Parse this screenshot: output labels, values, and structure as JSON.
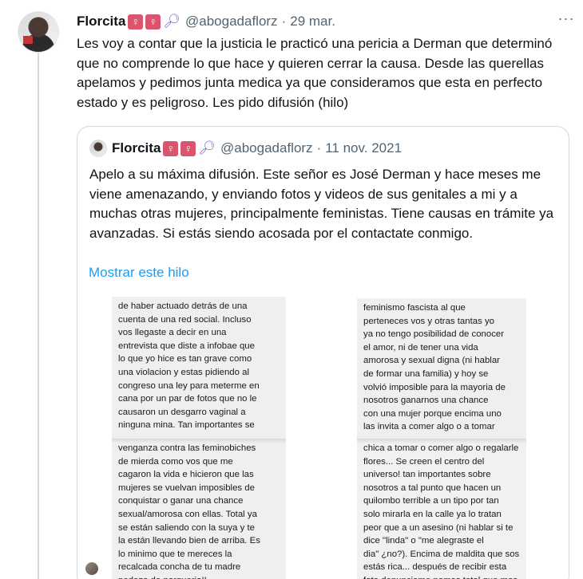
{
  "tweet": {
    "author_name": "Florcita",
    "emojis": [
      "♀",
      "♀"
    ],
    "handle": "@abogadaflorz",
    "separator": "·",
    "date": "29 mar.",
    "text": "Les voy a contar que la justicia le practicó una pericia a Derman que determinó que no comprende lo que hace y quieren cerrar la causa. Desde las querellas apelamos y pedimos junta medica ya que consideramos que esta en perfecto estado y es peligroso. Les pido difusión (hilo)",
    "more_label": "···"
  },
  "quoted_tweet": {
    "author_name": "Florcita",
    "emojis": [
      "♀",
      "♀"
    ],
    "handle": "@abogadaflorz",
    "separator": "·",
    "date": "11 nov. 2021",
    "text": "Apelo a su máxima difusión. Este señor es José Derman y hace meses me viene amenazando, y enviando fotos y videos de sus genitales a mi y a muchas otras mujeres, principalmente feministas. Tiene causas en trámite ya avanzadas. Si estás siendo acosada por el contactate conmigo.",
    "show_thread_label": "Mostrar este hilo"
  },
  "screenshots": [
    "de haber actuado detrás de una\ncuenta de una red social. Incluso\nvos llegaste a decir en una\nentrevista que diste a infobae que\nlo que yo hice es tan grave como\nuna violacion y estas pidiendo al\ncongreso una ley para meterme en\ncana por un par de fotos que no le\ncausaron un desgarro vaginal a\nninguna mina. Tan importantes se",
    "venganza contra las feminobiches\nde mierda como vos que me\ncagaron la vida e hicieron que las\nmujeres se vuelvan imposibles de\nconquistar o ganar una chance\nsexual/amorosa con ellas. Total ya\nse están saliendo con la suya y te\nla están llevando bien de arriba. Es\nlo minimo que te mereces la\nrecalcada concha de tu madre\npedazo de porqueria!!",
    "feminismo fascista al que\nperteneces vos y otras tantas yo\nya no tengo posibilidad de conocer\nel amor, ni de tener una vida\namorosa y sexual digna (ni hablar\nde formar una familia) y hoy se\nvolvió imposible para la mayoria de\nnosotros ganarnos una chance\ncon una mujer porque encima uno\nlas invita a comer algo o a tomar",
    "chica a tomar o comer algo o regalarle\nflores... Se creen el centro del\nuniverso! tan importantes sobre\nnosotros a tal punto que hacen un\nquilombo terrible a un tipo por tan\nsolo mirarla en la calle ya lo tratan\npeor que a un asesino (ni hablar si te\ndice  \"linda\" o \"me alegraste el\ndia\" ¿no?). Encima de maldita que sos\nestás rica... después de recibir esta\nfoto denunciame nomas total que mas"
  ],
  "colors": {
    "text": "#0f1419",
    "secondary": "#536471",
    "link": "#1d9bf0",
    "border": "#cfd9de",
    "emoji_bg": "#d9546c"
  }
}
